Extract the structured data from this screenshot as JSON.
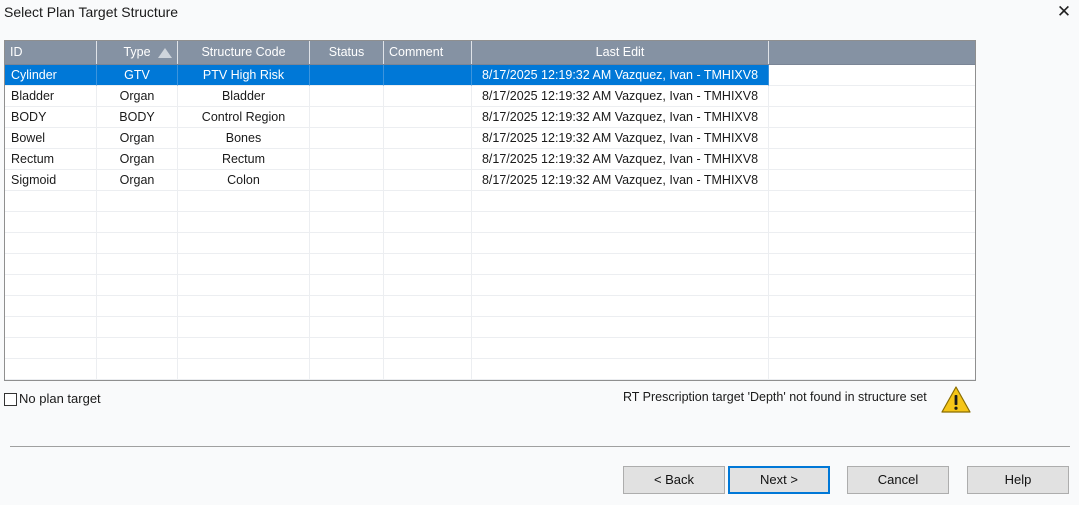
{
  "window": {
    "title": "Select Plan Target Structure",
    "close_glyph": "✕"
  },
  "grid": {
    "columns": [
      "ID",
      "Type",
      "Structure Code",
      "Status",
      "Comment",
      "Last Edit"
    ],
    "sorted_column": "Type",
    "rows": [
      [
        "Cylinder",
        "GTV",
        "PTV High Risk",
        "",
        "",
        "8/17/2025 12:19:32 AM Vazquez, Ivan - TMHIXV8"
      ],
      [
        "Bladder",
        "Organ",
        "Bladder",
        "",
        "",
        "8/17/2025 12:19:32 AM Vazquez, Ivan - TMHIXV8"
      ],
      [
        "BODY",
        "BODY",
        "Control Region",
        "",
        "",
        "8/17/2025 12:19:32 AM Vazquez, Ivan - TMHIXV8"
      ],
      [
        "Bowel",
        "Organ",
        "Bones",
        "",
        "",
        "8/17/2025 12:19:32 AM Vazquez, Ivan - TMHIXV8"
      ],
      [
        "Rectum",
        "Organ",
        "Rectum",
        "",
        "",
        "8/17/2025 12:19:32 AM Vazquez, Ivan - TMHIXV8"
      ],
      [
        "Sigmoid",
        "Organ",
        "Colon",
        "",
        "",
        "8/17/2025 12:19:32 AM Vazquez, Ivan - TMHIXV8"
      ]
    ],
    "selected_row": 0,
    "selection_color": "#0078d7",
    "header_color": "#8592a3"
  },
  "options": {
    "no_plan_target_label": "No plan target",
    "no_plan_target_checked": false
  },
  "warning": {
    "text": "RT Prescription target 'Depth' not found in structure set",
    "icon": "warning-triangle-icon"
  },
  "buttons": {
    "back": "< Back",
    "next": "Next >",
    "cancel": "Cancel",
    "help": "Help"
  }
}
